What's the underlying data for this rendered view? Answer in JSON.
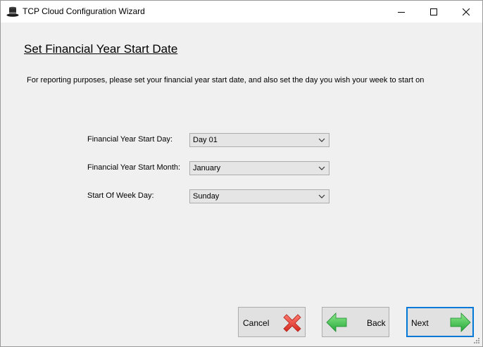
{
  "window": {
    "title": "TCP Cloud Configuration Wizard",
    "icons": {
      "app": "top-hat-icon",
      "minimize": "minimize-icon",
      "maximize": "maximize-icon",
      "close": "close-icon"
    }
  },
  "page": {
    "heading": "Set Financial Year Start Date",
    "intro": "For reporting purposes, please set your financial year start date, and also set the day you wish your week to start on"
  },
  "fields": [
    {
      "label": "Financial Year Start Day:",
      "value": "Day 01"
    },
    {
      "label": "Financial Year Start Month:",
      "value": "January"
    },
    {
      "label": "Start Of Week Day:",
      "value": "Sunday"
    }
  ],
  "buttons": {
    "cancel": {
      "label": "Cancel",
      "icon": "red-x-icon"
    },
    "back": {
      "label": "Back",
      "icon": "green-left-arrow-icon"
    },
    "next": {
      "label": "Next",
      "icon": "green-right-arrow-icon"
    }
  },
  "colors": {
    "focus_border": "#0078d7",
    "arrow_green": "#3cc33c",
    "cancel_red": "#e8403a"
  }
}
